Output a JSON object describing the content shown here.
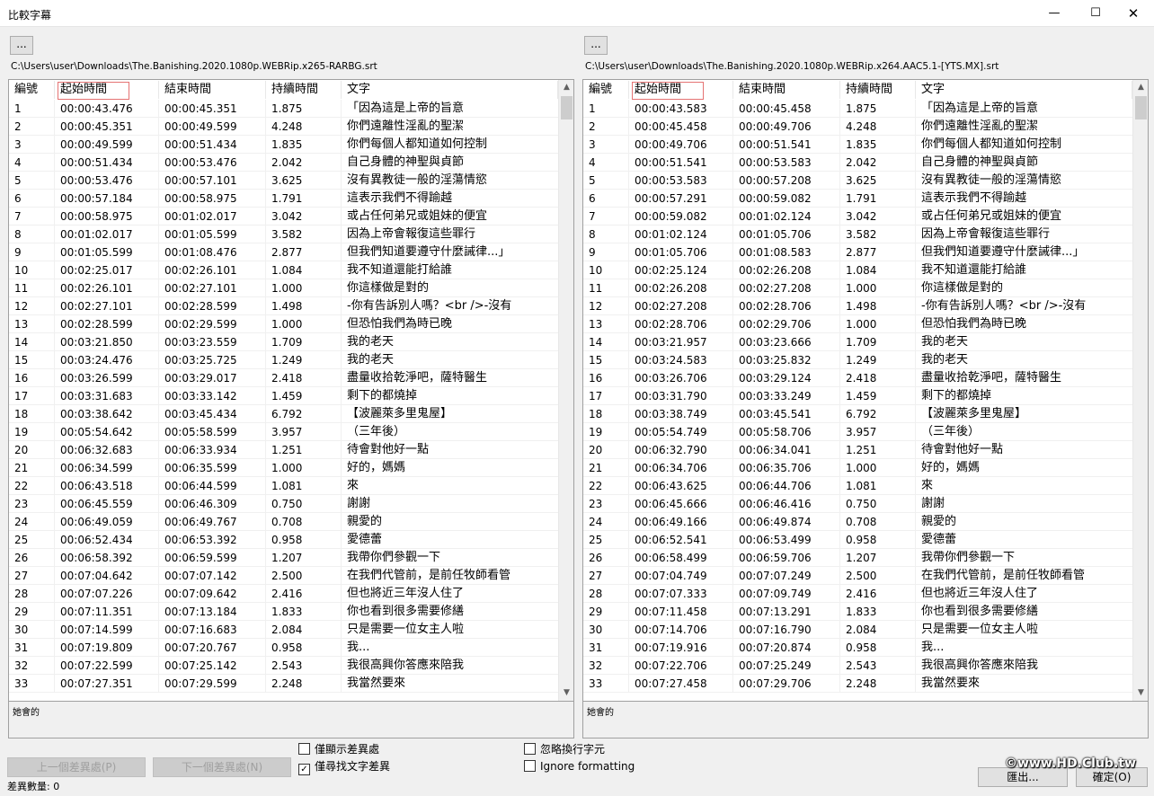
{
  "window": {
    "title": "比較字幕",
    "min_glyph": "—",
    "max_glyph": "☐",
    "close_glyph": "✕"
  },
  "left": {
    "browse_label": "...",
    "path": "C:\\Users\\user\\Downloads\\The.Banishing.2020.1080p.WEBRip.x265-RARBG.srt",
    "detail_text": "她會的",
    "rows": [
      [
        "1",
        "00:00:43.476",
        "00:00:45.351",
        "1.875",
        "「因為這是上帝的旨意"
      ],
      [
        "2",
        "00:00:45.351",
        "00:00:49.599",
        "4.248",
        "你們遠離性淫亂的聖潔"
      ],
      [
        "3",
        "00:00:49.599",
        "00:00:51.434",
        "1.835",
        "你們每個人都知道如何控制"
      ],
      [
        "4",
        "00:00:51.434",
        "00:00:53.476",
        "2.042",
        "自己身體的神聖與貞節"
      ],
      [
        "5",
        "00:00:53.476",
        "00:00:57.101",
        "3.625",
        "沒有異教徒一般的淫蕩情慾"
      ],
      [
        "6",
        "00:00:57.184",
        "00:00:58.975",
        "1.791",
        "這表示我們不得踰越"
      ],
      [
        "7",
        "00:00:58.975",
        "00:01:02.017",
        "3.042",
        "或占任何弟兄或姐妹的便宜"
      ],
      [
        "8",
        "00:01:02.017",
        "00:01:05.599",
        "3.582",
        "因為上帝會報復這些罪行"
      ],
      [
        "9",
        "00:01:05.599",
        "00:01:08.476",
        "2.877",
        "但我們知道要遵守什麼誡律...」"
      ],
      [
        "10",
        "00:02:25.017",
        "00:02:26.101",
        "1.084",
        "我不知道還能打給誰"
      ],
      [
        "11",
        "00:02:26.101",
        "00:02:27.101",
        "1.000",
        "你這樣做是對的"
      ],
      [
        "12",
        "00:02:27.101",
        "00:02:28.599",
        "1.498",
        "-你有告訴別人嗎？<br />-沒有"
      ],
      [
        "13",
        "00:02:28.599",
        "00:02:29.599",
        "1.000",
        "但恐怕我們為時已晚"
      ],
      [
        "14",
        "00:03:21.850",
        "00:03:23.559",
        "1.709",
        "我的老天"
      ],
      [
        "15",
        "00:03:24.476",
        "00:03:25.725",
        "1.249",
        "我的老天"
      ],
      [
        "16",
        "00:03:26.599",
        "00:03:29.017",
        "2.418",
        "盡量收拾乾淨吧，薩特醫生"
      ],
      [
        "17",
        "00:03:31.683",
        "00:03:33.142",
        "1.459",
        "剩下的都燒掉"
      ],
      [
        "18",
        "00:03:38.642",
        "00:03:45.434",
        "6.792",
        "【波麗萊多里鬼屋】"
      ],
      [
        "19",
        "00:05:54.642",
        "00:05:58.599",
        "3.957",
        "（三年後）"
      ],
      [
        "20",
        "00:06:32.683",
        "00:06:33.934",
        "1.251",
        "待會對他好一點"
      ],
      [
        "21",
        "00:06:34.599",
        "00:06:35.599",
        "1.000",
        "好的，媽媽"
      ],
      [
        "22",
        "00:06:43.518",
        "00:06:44.599",
        "1.081",
        "來"
      ],
      [
        "23",
        "00:06:45.559",
        "00:06:46.309",
        "0.750",
        "謝謝"
      ],
      [
        "24",
        "00:06:49.059",
        "00:06:49.767",
        "0.708",
        "親愛的"
      ],
      [
        "25",
        "00:06:52.434",
        "00:06:53.392",
        "0.958",
        "愛德蕾"
      ],
      [
        "26",
        "00:06:58.392",
        "00:06:59.599",
        "1.207",
        "我帶你們參觀一下"
      ],
      [
        "27",
        "00:07:04.642",
        "00:07:07.142",
        "2.500",
        "在我們代管前，是前任牧師看管"
      ],
      [
        "28",
        "00:07:07.226",
        "00:07:09.642",
        "2.416",
        "但也將近三年沒人住了"
      ],
      [
        "29",
        "00:07:11.351",
        "00:07:13.184",
        "1.833",
        "你也看到很多需要修繕"
      ],
      [
        "30",
        "00:07:14.599",
        "00:07:16.683",
        "2.084",
        "只是需要一位女主人啦"
      ],
      [
        "31",
        "00:07:19.809",
        "00:07:20.767",
        "0.958",
        "我..."
      ],
      [
        "32",
        "00:07:22.599",
        "00:07:25.142",
        "2.543",
        "我很高興你答應來陪我"
      ],
      [
        "33",
        "00:07:27.351",
        "00:07:29.599",
        "2.248",
        "我當然要來"
      ]
    ]
  },
  "right": {
    "browse_label": "...",
    "path": "C:\\Users\\user\\Downloads\\The.Banishing.2020.1080p.WEBRip.x264.AAC5.1-[YTS.MX].srt",
    "detail_text": "她會的",
    "rows": [
      [
        "1",
        "00:00:43.583",
        "00:00:45.458",
        "1.875",
        "「因為這是上帝的旨意"
      ],
      [
        "2",
        "00:00:45.458",
        "00:00:49.706",
        "4.248",
        "你們遠離性淫亂的聖潔"
      ],
      [
        "3",
        "00:00:49.706",
        "00:00:51.541",
        "1.835",
        "你們每個人都知道如何控制"
      ],
      [
        "4",
        "00:00:51.541",
        "00:00:53.583",
        "2.042",
        "自己身體的神聖與貞節"
      ],
      [
        "5",
        "00:00:53.583",
        "00:00:57.208",
        "3.625",
        "沒有異教徒一般的淫蕩情慾"
      ],
      [
        "6",
        "00:00:57.291",
        "00:00:59.082",
        "1.791",
        "這表示我們不得踰越"
      ],
      [
        "7",
        "00:00:59.082",
        "00:01:02.124",
        "3.042",
        "或占任何弟兄或姐妹的便宜"
      ],
      [
        "8",
        "00:01:02.124",
        "00:01:05.706",
        "3.582",
        "因為上帝會報復這些罪行"
      ],
      [
        "9",
        "00:01:05.706",
        "00:01:08.583",
        "2.877",
        "但我們知道要遵守什麼誡律...」"
      ],
      [
        "10",
        "00:02:25.124",
        "00:02:26.208",
        "1.084",
        "我不知道還能打給誰"
      ],
      [
        "11",
        "00:02:26.208",
        "00:02:27.208",
        "1.000",
        "你這樣做是對的"
      ],
      [
        "12",
        "00:02:27.208",
        "00:02:28.706",
        "1.498",
        "-你有告訴別人嗎？<br />-沒有"
      ],
      [
        "13",
        "00:02:28.706",
        "00:02:29.706",
        "1.000",
        "但恐怕我們為時已晚"
      ],
      [
        "14",
        "00:03:21.957",
        "00:03:23.666",
        "1.709",
        "我的老天"
      ],
      [
        "15",
        "00:03:24.583",
        "00:03:25.832",
        "1.249",
        "我的老天"
      ],
      [
        "16",
        "00:03:26.706",
        "00:03:29.124",
        "2.418",
        "盡量收拾乾淨吧，薩特醫生"
      ],
      [
        "17",
        "00:03:31.790",
        "00:03:33.249",
        "1.459",
        "剩下的都燒掉"
      ],
      [
        "18",
        "00:03:38.749",
        "00:03:45.541",
        "6.792",
        "【波麗萊多里鬼屋】"
      ],
      [
        "19",
        "00:05:54.749",
        "00:05:58.706",
        "3.957",
        "（三年後）"
      ],
      [
        "20",
        "00:06:32.790",
        "00:06:34.041",
        "1.251",
        "待會對他好一點"
      ],
      [
        "21",
        "00:06:34.706",
        "00:06:35.706",
        "1.000",
        "好的，媽媽"
      ],
      [
        "22",
        "00:06:43.625",
        "00:06:44.706",
        "1.081",
        "來"
      ],
      [
        "23",
        "00:06:45.666",
        "00:06:46.416",
        "0.750",
        "謝謝"
      ],
      [
        "24",
        "00:06:49.166",
        "00:06:49.874",
        "0.708",
        "親愛的"
      ],
      [
        "25",
        "00:06:52.541",
        "00:06:53.499",
        "0.958",
        "愛德蕾"
      ],
      [
        "26",
        "00:06:58.499",
        "00:06:59.706",
        "1.207",
        "我帶你們參觀一下"
      ],
      [
        "27",
        "00:07:04.749",
        "00:07:07.249",
        "2.500",
        "在我們代管前，是前任牧師看管"
      ],
      [
        "28",
        "00:07:07.333",
        "00:07:09.749",
        "2.416",
        "但也將近三年沒人住了"
      ],
      [
        "29",
        "00:07:11.458",
        "00:07:13.291",
        "1.833",
        "你也看到很多需要修繕"
      ],
      [
        "30",
        "00:07:14.706",
        "00:07:16.790",
        "2.084",
        "只是需要一位女主人啦"
      ],
      [
        "31",
        "00:07:19.916",
        "00:07:20.874",
        "0.958",
        "我..."
      ],
      [
        "32",
        "00:07:22.706",
        "00:07:25.249",
        "2.543",
        "我很高興你答應來陪我"
      ],
      [
        "33",
        "00:07:27.458",
        "00:07:29.706",
        "2.248",
        "我當然要來"
      ]
    ]
  },
  "columns": [
    "編號",
    "起始時間",
    "結束時間",
    "持續時間",
    "文字"
  ],
  "scroll_up_glyph": "▲",
  "scroll_down_glyph": "▼",
  "controls": {
    "prev_diff": "上一個差異處(P)",
    "next_diff": "下一個差異處(N)",
    "only_show_diff": "僅顯示差異處",
    "only_show_diff_checked": false,
    "text_only": "僅尋找文字差異",
    "text_only_checked": true,
    "ignore_linebreak": "忽略換行字元",
    "ignore_linebreak_checked": false,
    "ignore_formatting": "Ignore formatting",
    "ignore_formatting_checked": false,
    "export": "匯出...",
    "ok": "確定(O)",
    "check_glyph": "✓"
  },
  "status": "差異數量: 0",
  "watermark": "©www.HD.Club.tw"
}
